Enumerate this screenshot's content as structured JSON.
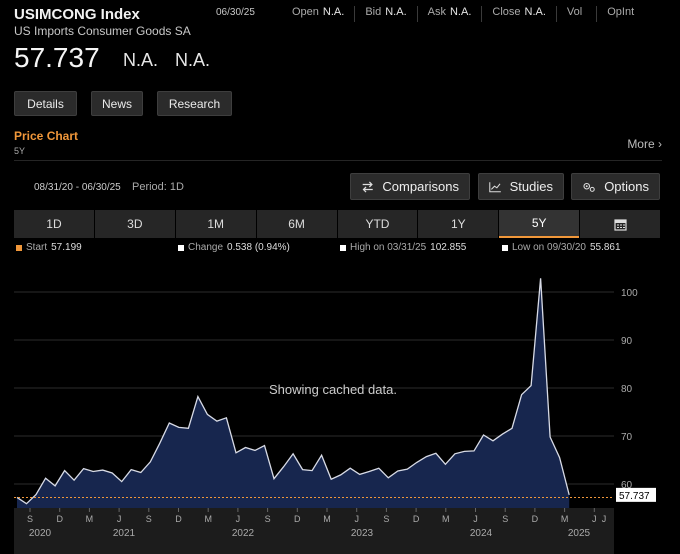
{
  "header": {
    "ticker": "USIMCONG Index",
    "company": "US Imports Consumer Goods SA",
    "date": "06/30/25",
    "price": "57.737",
    "change": "N.A.",
    "change_pct": "N.A."
  },
  "quote": [
    {
      "label": "Open",
      "value": "N.A."
    },
    {
      "label": "Bid",
      "value": "N.A."
    },
    {
      "label": "Ask",
      "value": "N.A."
    },
    {
      "label": "Close",
      "value": "N.A."
    },
    {
      "label": "Vol",
      "value": ""
    },
    {
      "label": "OpInt",
      "value": ""
    }
  ],
  "actions": {
    "details": "Details",
    "news": "News",
    "research": "Research"
  },
  "section": {
    "title": "Price Chart",
    "subtitle": "5Y",
    "more": "More"
  },
  "toolbar": {
    "range": "08/31/20 - 06/30/25",
    "period": "Period: 1D",
    "comparisons": "Comparisons",
    "studies": "Studies",
    "options": "Options"
  },
  "tabs": {
    "t1": "1D",
    "t2": "3D",
    "t3": "1M",
    "t4": "6M",
    "t5": "YTD",
    "t6": "1Y",
    "t7": "5Y",
    "active": "5Y"
  },
  "stats": {
    "start_label": "Start",
    "start_value": "57.199",
    "change_label": "Change",
    "change_value": "0.538 (0.94%)",
    "high_label": "High on 03/31/25",
    "high_value": "102.855",
    "low_label": "Low on 09/30/20",
    "low_value": "55.861"
  },
  "colors": {
    "accent": "#f0973a",
    "area": "#17264e",
    "line": "#d8dbe6",
    "last_price": "#f0973a"
  },
  "message": "Showing cached data.",
  "chart_data": {
    "type": "area",
    "x_start": "2020-08-31",
    "x_end": "2025-06-30",
    "step": "month",
    "values": [
      57.2,
      55.9,
      57.8,
      61.2,
      59.6,
      62.8,
      60.8,
      63.2,
      62.6,
      62.9,
      62.3,
      60.5,
      63.0,
      62.4,
      64.6,
      68.5,
      72.7,
      71.8,
      71.6,
      78.2,
      74.5,
      73.1,
      73.8,
      66.5,
      67.6,
      67.0,
      68.0,
      61.1,
      63.6,
      66.3,
      63.0,
      62.8,
      66.0,
      61.0,
      61.9,
      63.3,
      62.0,
      62.6,
      63.3,
      61.3,
      62.7,
      63.1,
      64.5,
      65.7,
      66.4,
      64.1,
      66.3,
      66.8,
      66.9,
      70.2,
      69.0,
      70.4,
      71.6,
      78.6,
      80.5,
      102.855,
      69.8,
      65.5,
      57.737
    ],
    "ylim": [
      55,
      105
    ],
    "yticks": [
      "60",
      "70",
      "80",
      "90",
      "100"
    ],
    "month_ticks": [
      "S",
      "D",
      "M",
      "J",
      "S",
      "D",
      "M",
      "J",
      "S",
      "D",
      "M",
      "J",
      "S",
      "D",
      "M",
      "J",
      "S",
      "D",
      "M",
      "J"
    ],
    "year_labels": [
      "2020",
      "2021",
      "2022",
      "2023",
      "2024",
      "2025"
    ],
    "last_price": "57.737",
    "grid": true
  }
}
